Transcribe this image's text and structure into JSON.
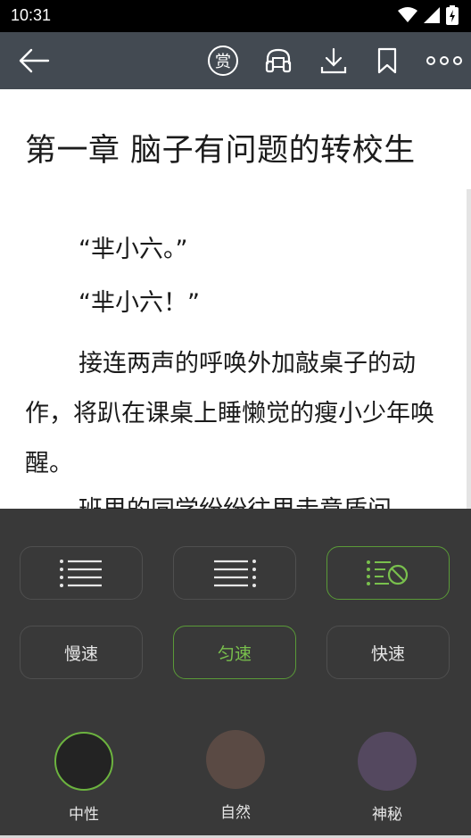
{
  "status_bar": {
    "time": "10:31"
  },
  "toolbar": {
    "reward_label": "赏"
  },
  "content": {
    "chapter_title": "第一章  脑子有问题的转校生",
    "paragraphs": [
      "“芈小六。”",
      "“芈小六！”",
      "接连两声的呼唤外加敲桌子的动作，将趴在课桌上睡懒觉的瘦小少年唤醒。",
      "班里的同学纷纷往里走意质问"
    ]
  },
  "panel": {
    "speeds": [
      "慢速",
      "匀速",
      "快速"
    ],
    "active_speed": "匀速",
    "voices": [
      {
        "label": "中性",
        "color": "#232323"
      },
      {
        "label": "自然",
        "color": "#5a4a44"
      },
      {
        "label": "神秘",
        "color": "#54485f"
      }
    ],
    "active_voice": "中性",
    "accent": "#6cb33f"
  }
}
